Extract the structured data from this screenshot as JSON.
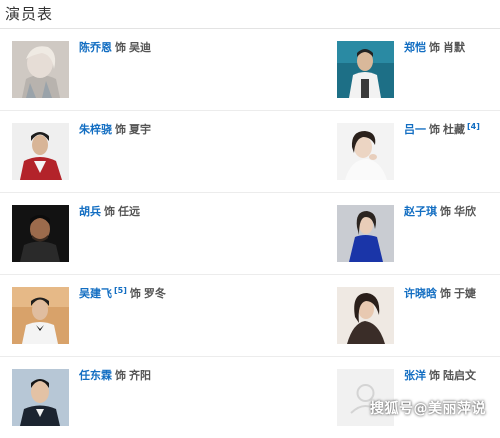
{
  "section": {
    "title": "演员表"
  },
  "cast": [
    {
      "actor": "陈乔恩",
      "prefix": "饰",
      "role": "吴迪",
      "ref": ""
    },
    {
      "actor": "郑恺",
      "prefix": "饰",
      "role": "肖默",
      "ref": ""
    },
    {
      "actor": "朱梓骁",
      "prefix": "饰",
      "role": "夏宇",
      "ref": ""
    },
    {
      "actor": "吕一",
      "prefix": "饰",
      "role": "杜藏",
      "ref": "[4]"
    },
    {
      "actor": "胡兵",
      "prefix": "饰",
      "role": "任远",
      "ref": ""
    },
    {
      "actor": "赵子琪",
      "prefix": "饰",
      "role": "华欣",
      "ref": ""
    },
    {
      "actor": "吴建飞",
      "prefix": "饰",
      "role": "罗冬",
      "ref": "[5]"
    },
    {
      "actor": "许晓晗",
      "prefix": "饰",
      "role": "于婕",
      "ref": ""
    },
    {
      "actor": "任东霖",
      "prefix": "饰",
      "role": "齐阳",
      "ref": ""
    },
    {
      "actor": "张洋",
      "prefix": "饰",
      "role": "陆启文",
      "ref": ""
    }
  ],
  "watermark": "搜狐号@美丽萍说"
}
